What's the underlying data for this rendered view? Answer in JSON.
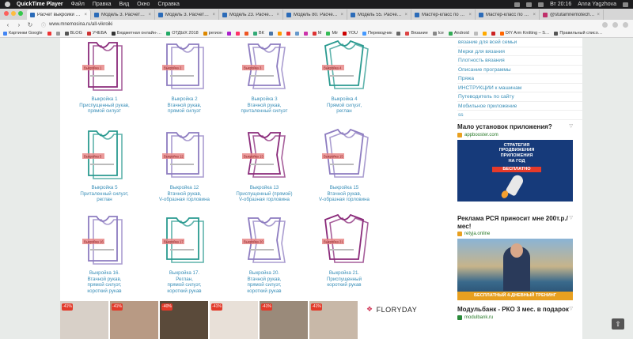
{
  "menubar": {
    "app": "QuickTime Player",
    "items": [
      "Файл",
      "Правка",
      "Вид",
      "Окно",
      "Справка"
    ],
    "clock": "Вт 20:16",
    "user": "Anna Yagzhova"
  },
  "tabs": [
    {
      "label": "Расчет выкройки вязани…",
      "active": true
    },
    {
      "label": "Модель 3. Расчет выкройк…",
      "active": false
    },
    {
      "label": "Модель 3. Расчет выкройк…",
      "active": false
    },
    {
      "label": "Модель 23. Расчет выкро…",
      "active": false
    },
    {
      "label": "Модель 80. Расчет выкро…",
      "active": false
    },
    {
      "label": "Модель 55. Расчет выкро…",
      "active": false
    },
    {
      "label": "Мастер-класс по вязани…",
      "active": false
    },
    {
      "label": "Мастер-класс по вязани…",
      "active": false
    },
    {
      "label": "@stutamnemotechna • Фото…",
      "active": false
    }
  ],
  "toolbar": {
    "url": "www.mnemosina.ru/all-vikroiki"
  },
  "bookmarks": [
    "Картинки Google",
    "",
    "",
    "BLOG",
    "УЧЕБА",
    "Бюджетная онлайн-…",
    "ОТДЫХ 2018",
    "регион",
    "",
    "",
    "",
    "ВК",
    "",
    "",
    "",
    "",
    "",
    "М",
    "Mir",
    "YOU",
    "Переводчик",
    "",
    "Вязание",
    "lce",
    "Android",
    "",
    "",
    "",
    "DIY Arm Knitting – S…",
    "Правильный списо…"
  ],
  "patterns": [
    {
      "tag": "Выкройка 1",
      "caption": "Выкройка 1\nПриспущенный рукав,\nпрямой силуэт",
      "color": "#8a2a7a"
    },
    {
      "tag": "Выкройка 2",
      "caption": "Выкройка 2\nВтачной рукав,\nпрямой силуэт",
      "color": "#8d7cc0"
    },
    {
      "tag": "Выкройка 3",
      "caption": "Выкройка 3\nВтачной рукав,\nприталенный силуэт",
      "color": "#8d7cc0"
    },
    {
      "tag": "Выкройка 4",
      "caption": "Выкройка 4\nПрямой силуэт,\nреглан",
      "color": "#2a9a90"
    },
    {
      "tag": "Выкройка 5",
      "caption": "Выкройка 5\nПриталенный силуэт,\nреглан",
      "color": "#2a9a90"
    },
    {
      "tag": "Выкройка 12",
      "caption": "Выкройка 12\nВтачной рукав,\nV-образная горловина",
      "color": "#8d7cc0"
    },
    {
      "tag": "Выкройка 13",
      "caption": "Выкройка 13\nПриспущенный (прямой)\nV-образная горловина",
      "color": "#8a2a7a"
    },
    {
      "tag": "Выкройка 15",
      "caption": "Выкройка 15\nВтачной рукав,\nV-образная горловина",
      "color": "#8d7cc0"
    },
    {
      "tag": "Выкройка 16",
      "caption": "Выкройка 16.\nВтачной рукав,\nпрямой силуэт,\nкороткий рукав",
      "color": "#8d7cc0"
    },
    {
      "tag": "Выкройка 17",
      "caption": "Выкройка 17.\nРеглан,\nпрямой силуэт,\nкороткий рукав",
      "color": "#2a9a90"
    },
    {
      "tag": "Выкройка 20",
      "caption": "Выкройка 20.\nВтачной рукав,\nпрямой силуэт,\nкороткий рукав",
      "color": "#8d7cc0"
    },
    {
      "tag": "Выкройка 21",
      "caption": "Выкройка 21.\nПриспущенный\nкороткий рукав",
      "color": "#8a2a7a"
    }
  ],
  "sidebar": {
    "links": [
      "вязание для всей семьи",
      "Мерки для вязания",
      "Плотность вязания",
      "Описание программы",
      "Пряжа",
      "ИНСТРУКЦИИ к машинам",
      "Путеводитель по сайту",
      "Мобильное приложение",
      "ss"
    ],
    "ad1": {
      "title": "Мало установок приложения?",
      "source": "appbooster.com",
      "banner_line1": "СТРАТЕГИЯ\nПРОДВИЖЕНИЯ\nПРИЛОЖЕНИЯ\nНА ГОД",
      "banner_free": "БЕСПЛАТНО"
    },
    "ad2": {
      "title": "Реклама РСЯ приносит мне 200т.р./мес!",
      "source": "retyja.online",
      "banner": "БЕСПЛАТНЫЙ 4-ДНЕВНЫЙ ТРЕНИНГ"
    },
    "ad3": {
      "title": "Модульбанк - РКО 3 мес. в подарок",
      "source": "modulbank.ru"
    }
  },
  "strip": {
    "badges": [
      "-41%",
      "-41%",
      "-40%",
      "-41%",
      "-41%",
      "-41%"
    ],
    "brand": "FLORYDAY"
  }
}
